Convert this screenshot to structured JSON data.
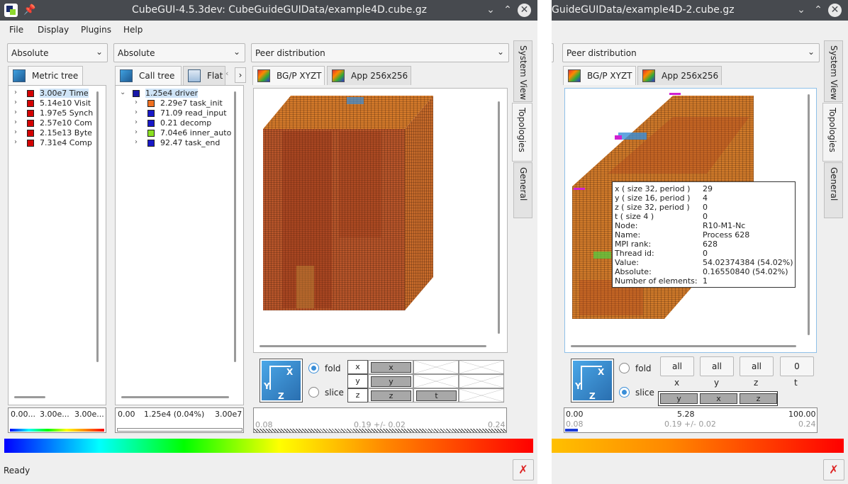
{
  "left": {
    "title": "CubeGUI-4.5.3dev: CubeGuideGUIData/example4D.cube.gz",
    "menu": [
      "File",
      "Display",
      "Plugins",
      "Help"
    ],
    "metric_pane": {
      "mode": "Absolute",
      "tab": "Metric tree",
      "items": [
        {
          "value": "3.00e7",
          "name": "Time",
          "color": "#d40000",
          "selected": true
        },
        {
          "value": "5.14e10",
          "name": "Visit",
          "color": "#d40000"
        },
        {
          "value": "1.97e5",
          "name": "Synch",
          "color": "#d40000"
        },
        {
          "value": "2.57e10",
          "name": "Com",
          "color": "#d40000"
        },
        {
          "value": "2.15e13",
          "name": "Byte",
          "color": "#d40000"
        },
        {
          "value": "7.31e4",
          "name": "Comp",
          "color": "#d40000"
        }
      ],
      "footer": [
        "0.00...",
        "3.00e...",
        "3.00e..."
      ]
    },
    "call_pane": {
      "mode": "Absolute",
      "tabs": [
        "Call tree",
        "Flat"
      ],
      "root": {
        "value": "1.25e4",
        "name": "driver",
        "color": "#1818a8"
      },
      "children": [
        {
          "value": "2.29e7",
          "name": "task_init",
          "color": "#f07020"
        },
        {
          "value": "71.09",
          "name": "read_input",
          "color": "#1818c8"
        },
        {
          "value": "0.21",
          "name": "decomp",
          "color": "#1818c8"
        },
        {
          "value": "7.04e6",
          "name": "inner_auto",
          "color": "#8ae020"
        },
        {
          "value": "92.47",
          "name": "task_end",
          "color": "#1818c8"
        }
      ],
      "footer": [
        "0.00",
        "1.25e4 (0.04%)",
        "3.00e7"
      ]
    },
    "system_pane": {
      "mode": "Peer distribution",
      "tabs": [
        "BG/P XYZT",
        "App 256x256"
      ],
      "fold_label": "fold",
      "slice_label": "slice",
      "mode_selected": "fold",
      "dim_rows": [
        {
          "axis": "x",
          "slots": [
            "x",
            "",
            ""
          ]
        },
        {
          "axis": "y",
          "slots": [
            "y",
            "",
            ""
          ]
        },
        {
          "axis": "z",
          "slots": [
            "z",
            "t",
            ""
          ]
        }
      ],
      "scale": {
        "min": "0.08",
        "mid": "0.19 +/- 0.02",
        "max": "0.24"
      }
    },
    "side_tabs": [
      "System View",
      "Topologies",
      "General"
    ],
    "status": "Ready"
  },
  "right": {
    "title": "GuideGUIData/example4D-2.cube.gz",
    "mode": "Peer distribution",
    "tabs": [
      "BG/P XYZT",
      "App 256x256"
    ],
    "fold_label": "fold",
    "slice_label": "slice",
    "mode_selected": "slice",
    "dim_buttons": [
      "all",
      "all",
      "all",
      "0"
    ],
    "dim_labels": [
      "x",
      "y",
      "z",
      "t"
    ],
    "order_buttons": [
      "y",
      "x",
      "z"
    ],
    "scale": {
      "min": "0.00",
      "mid": "5.28",
      "max": "100.00",
      "min2": "0.08",
      "mid2": "0.19 +/- 0.02",
      "max2": "0.24"
    },
    "side_tabs": [
      "System View",
      "Topologies",
      "General"
    ],
    "tooltip": [
      {
        "k": "x ( size 32, period  )",
        "v": "29"
      },
      {
        "k": "y ( size 16, period  )",
        "v": "4"
      },
      {
        "k": "z ( size 32, period  )",
        "v": "0"
      },
      {
        "k": "t ( size 4 )",
        "v": "0"
      },
      {
        "k": "Node:",
        "v": "R10-M1-Nc"
      },
      {
        "k": "Name:",
        "v": "Process 628"
      },
      {
        "k": "MPI rank:",
        "v": "628"
      },
      {
        "k": "Thread id:",
        "v": "0"
      },
      {
        "k": "Value:",
        "v": "54.02374384 (54.02%)"
      },
      {
        "k": "Absolute:",
        "v": "0.16550840 (54.02%)"
      },
      {
        "k": "Number of elements:",
        "v": "1"
      }
    ]
  }
}
